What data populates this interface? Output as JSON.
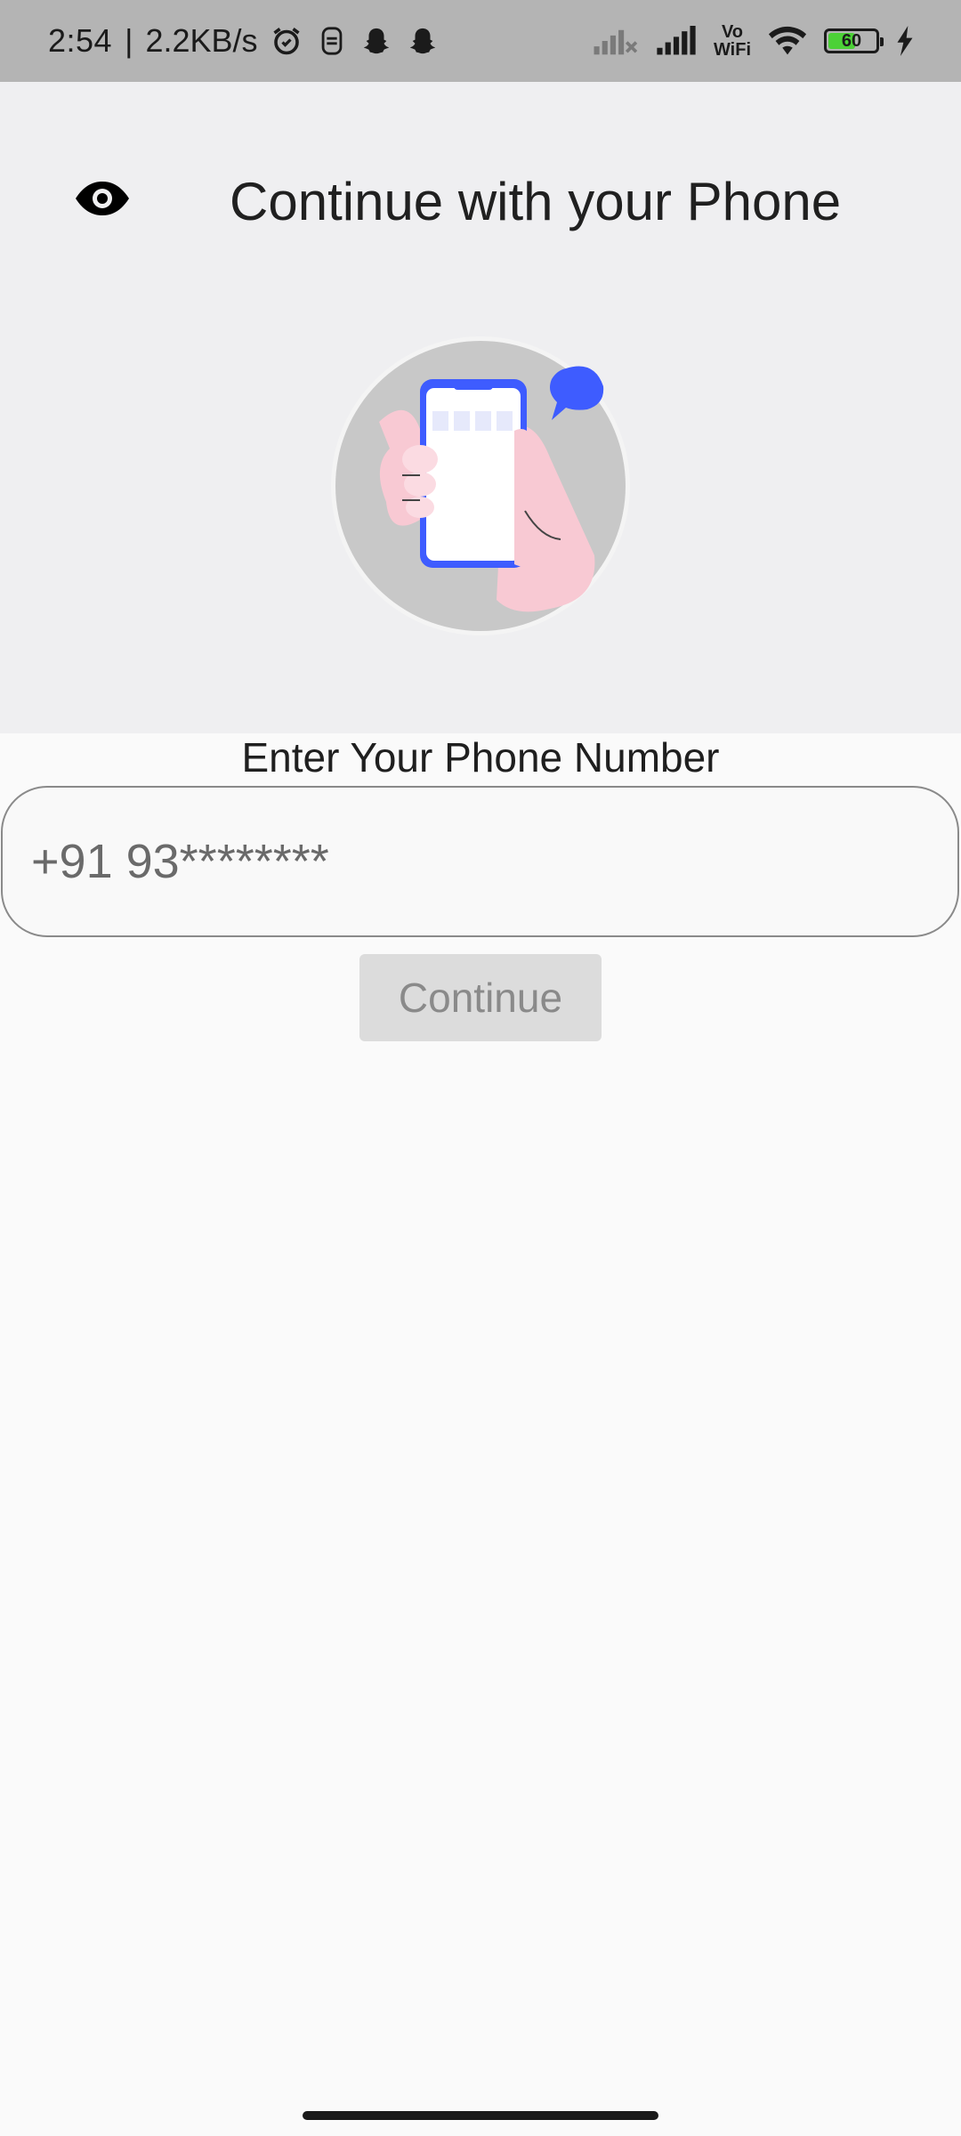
{
  "status_bar": {
    "time": "2:54",
    "separator": "|",
    "network_speed": "2.2KB/s",
    "vowifi_line1": "Vo",
    "vowifi_line2": "WiFi",
    "battery_level": "60",
    "battery_fraction": 0.6,
    "icons": [
      "alarm-icon",
      "notification-icon",
      "snapchat-icon",
      "snapchat-icon",
      "signal-off-icon",
      "signal-icon",
      "wifi-icon",
      "battery-icon",
      "charging-icon"
    ]
  },
  "header": {
    "title": "Continue with your Phone",
    "toggle_icon": "eye-icon"
  },
  "illustration": {
    "name": "hand-holding-phone-illustration",
    "colors": {
      "circle": "#c8c8c8",
      "phone_frame": "#3e5cff",
      "bubble": "#3e5cff",
      "hand": "#f8c9d3"
    }
  },
  "form": {
    "label": "Enter Your Phone Number",
    "phone_value": "+91 93********",
    "continue_label": "Continue"
  },
  "colors": {
    "status_bar_bg": "#b4b4b4",
    "header_bg": "#efeff1",
    "page_bg": "#fafafa",
    "button_disabled_bg": "#dcdcdc",
    "button_disabled_text": "#8a8a8a"
  }
}
